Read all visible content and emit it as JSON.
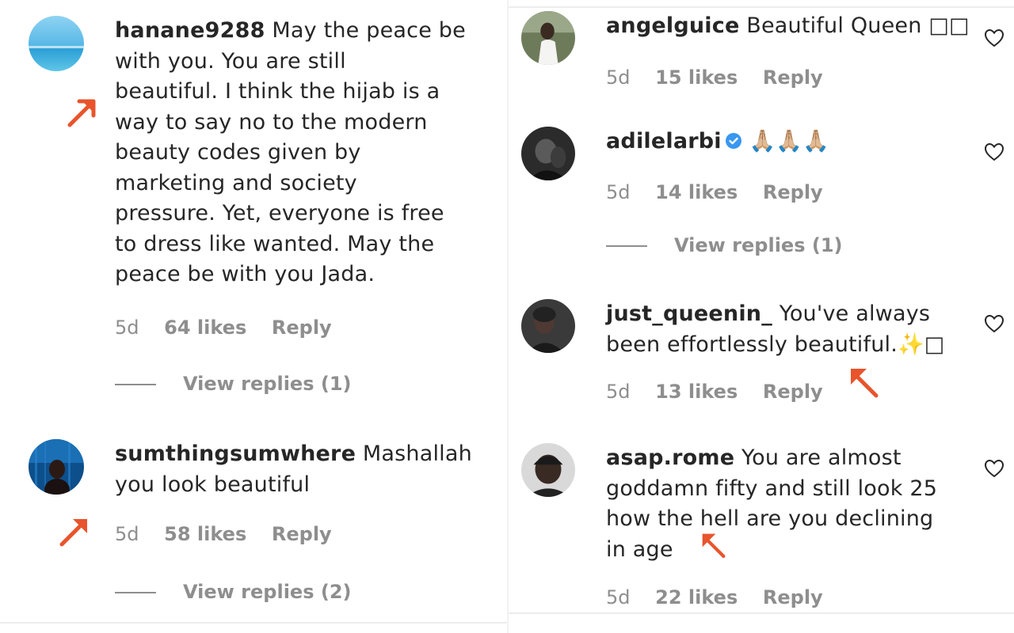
{
  "colors": {
    "text": "#262626",
    "meta": "#8e8e8e",
    "arrow": "#e8542c",
    "verified": "#3897f0"
  },
  "left": {
    "comments": [
      {
        "username": "hanane9288",
        "lines": [
          "May the peace be",
          "with you. You are still",
          "beautiful. I think the hijab is a",
          "way to say no to the modern",
          "beauty codes given by",
          "marketing and society",
          "pressure. Yet, everyone is free",
          "to dress like wanted. May the",
          "peace be with you Jada."
        ],
        "age": "5d",
        "likes": "64 likes",
        "reply": "Reply",
        "view_replies": "View replies (1)"
      },
      {
        "username": "sumthingsumwhere",
        "lines": [
          "Mashallah",
          "you look beautiful"
        ],
        "age": "5d",
        "likes": "58 likes",
        "reply": "Reply",
        "view_replies": "View replies (2)"
      }
    ]
  },
  "right": {
    "comments": [
      {
        "username": "angelguice",
        "lines": [
          "Beautiful Queen □□"
        ],
        "age": "5d",
        "likes": "15 likes",
        "reply": "Reply"
      },
      {
        "username": "adilelarbi",
        "emoji": "🙏🏼🙏🏼🙏🏼",
        "age": "5d",
        "likes": "14 likes",
        "reply": "Reply",
        "view_replies": "View replies (1)"
      },
      {
        "username": "just_queenin_",
        "lines": [
          "You've always",
          "been effortlessly beautiful.✨□"
        ],
        "age": "5d",
        "likes": "13 likes",
        "reply": "Reply"
      },
      {
        "username": "asap.rome",
        "lines": [
          "You are almost",
          "goddamn fifty and still look 25",
          "how the hell are you declining",
          "in age"
        ],
        "age": "5d",
        "likes": "22 likes",
        "reply": "Reply"
      }
    ]
  },
  "icons": {
    "heart": "heart-outline-icon",
    "verified": "verified-badge-icon",
    "arrow": "annotation-arrow-icon"
  }
}
